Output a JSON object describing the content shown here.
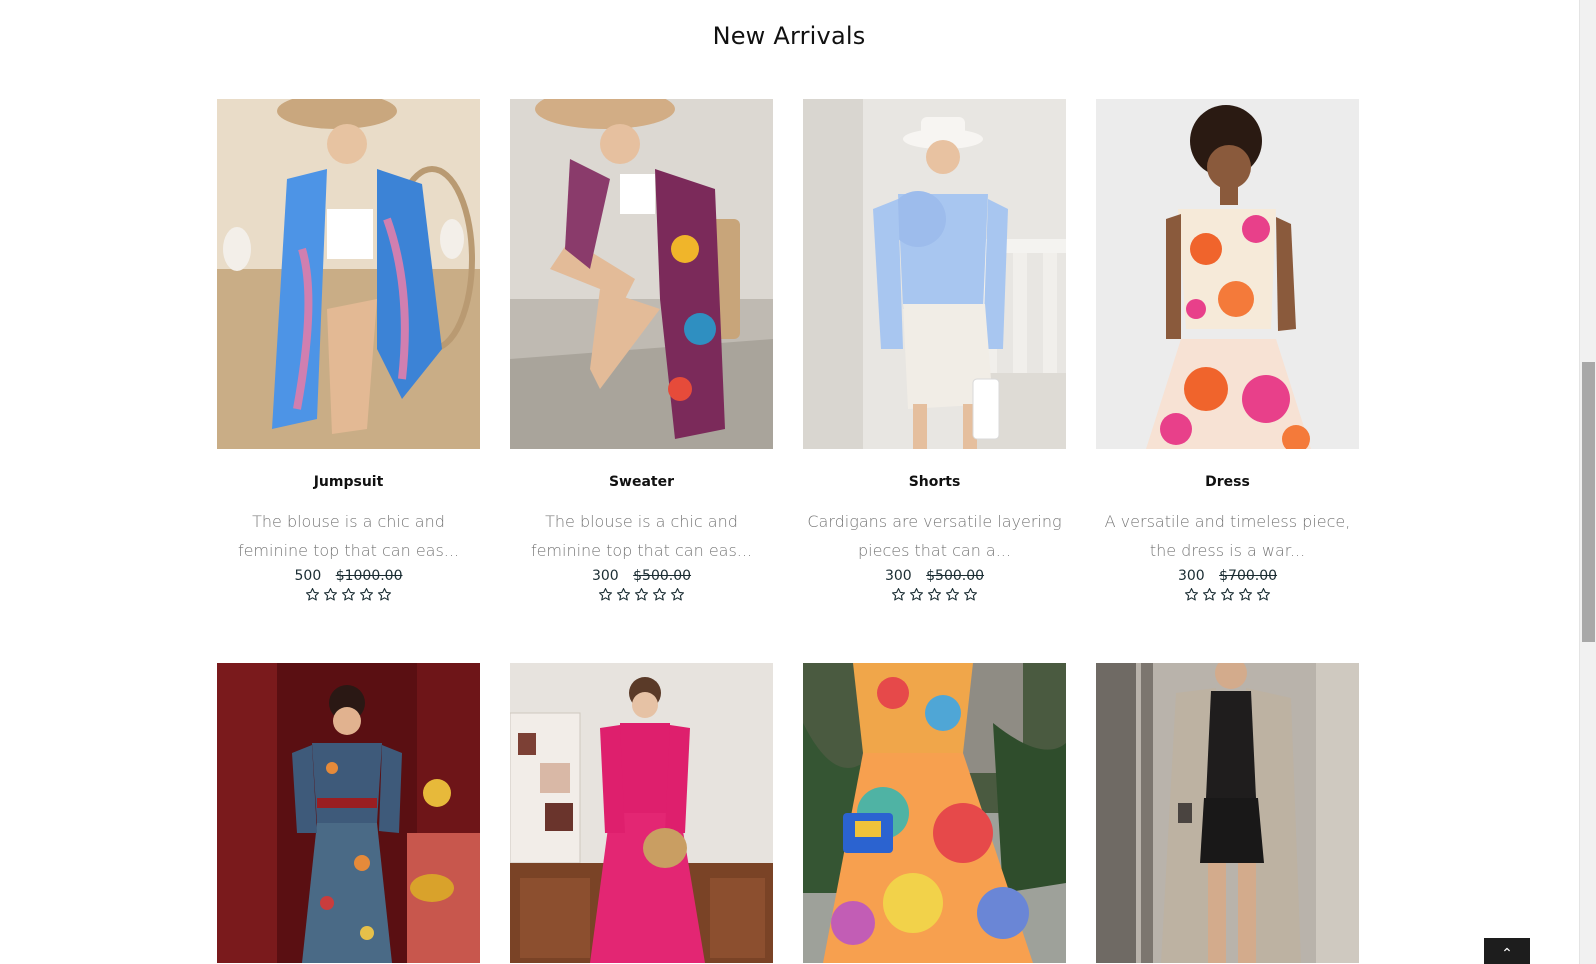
{
  "section": {
    "title": "New Arrivals"
  },
  "products": [
    {
      "name": "Jumpsuit",
      "description": "The blouse is a chic and feminine top that can eas...",
      "price": "500",
      "old_price": "$1000.00",
      "rating": 0,
      "max_rating": 5,
      "image": "woman in blue patterned kimono on rattan chair"
    },
    {
      "name": "Sweater",
      "description": "The blouse is a chic and feminine top that can eas...",
      "price": "300",
      "old_price": "$500.00",
      "rating": 0,
      "max_rating": 5,
      "image": "woman in multicolor boho kimono on chair"
    },
    {
      "name": "Shorts",
      "description": "Cardigans are versatile layering pieces that can a...",
      "price": "300",
      "old_price": "$500.00",
      "rating": 0,
      "max_rating": 5,
      "image": "woman in blue ruffle blouse and white skirt"
    },
    {
      "name": "Dress",
      "description": "A versatile and timeless piece, the dress is a war...",
      "price": "300",
      "old_price": "$700.00",
      "rating": 0,
      "max_rating": 5,
      "image": "woman in floral crop top and skirt set"
    },
    {
      "image": "woman in printed jumpsuit with red curtains"
    },
    {
      "image": "woman in pink long dress with straw bag"
    },
    {
      "image": "woman in colorful tiered maxi dress"
    },
    {
      "image": "woman in sequin long cardigan"
    }
  ],
  "back_to_top": {
    "icon": "chevron-up-icon",
    "glyph": "⌃"
  }
}
